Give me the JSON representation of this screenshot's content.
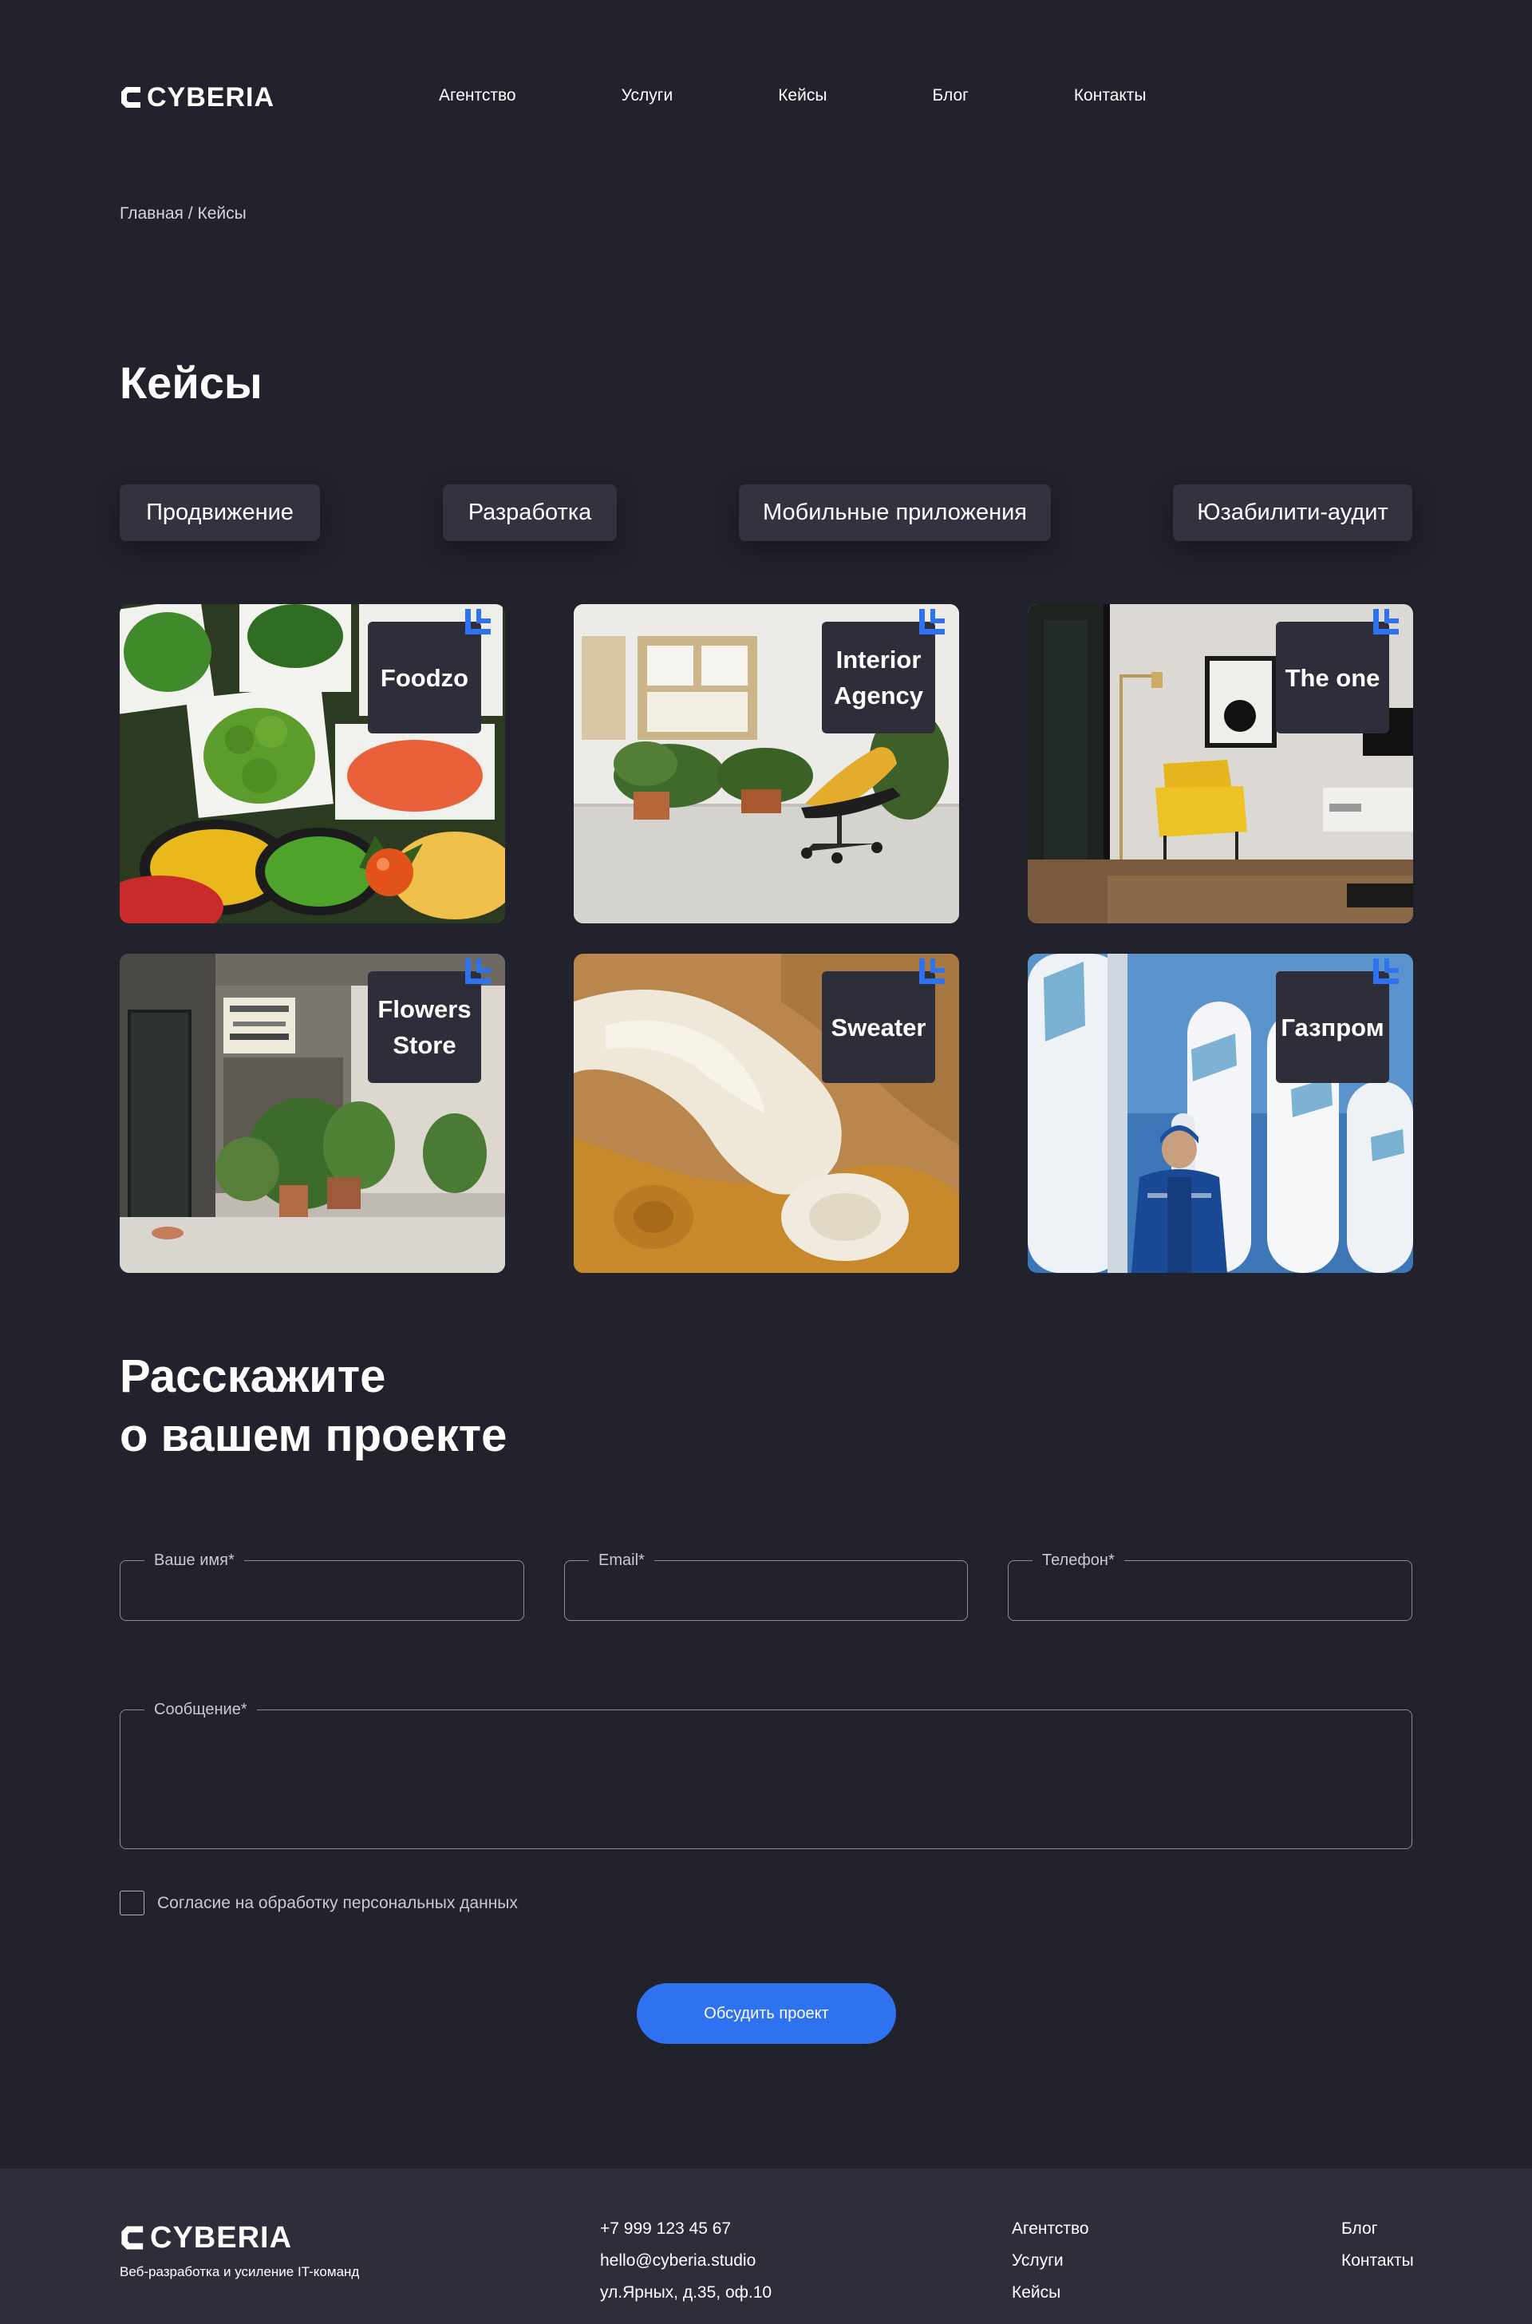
{
  "header": {
    "logo_text": "CYBERIA",
    "nav": [
      "Агентство",
      "Услуги",
      "Кейсы",
      "Блог",
      "Контакты"
    ]
  },
  "breadcrumb": {
    "home": "Главная",
    "separator": "/",
    "current": "Кейсы"
  },
  "page_title": "Кейсы",
  "filters": [
    "Продвижение",
    "Разработка",
    "Мобильные приложения",
    "Юзабилити-аудит"
  ],
  "cases": [
    {
      "label_1": "Foodzo",
      "label_2": ""
    },
    {
      "label_1": "Interior",
      "label_2": "Agency"
    },
    {
      "label_1": "The one",
      "label_2": ""
    },
    {
      "label_1": "Flowers",
      "label_2": "Store"
    },
    {
      "label_1": "Sweater",
      "label_2": ""
    },
    {
      "label_1": "Газпром",
      "label_2": ""
    }
  ],
  "form": {
    "title_line1": "Расскажите",
    "title_line2": "о вашем проекте",
    "name_label": "Ваше имя*",
    "name_value": "",
    "email_label": "Email*",
    "email_value": "",
    "phone_label": "Телефон*",
    "phone_value": "",
    "message_label": "Сообщение*",
    "message_value": "",
    "consent_text": "Согласие на обработку персональных данных",
    "consent_checked": false,
    "submit_label": "Обсудить проект"
  },
  "footer": {
    "logo_text": "CYBERIA",
    "tagline": "Веб-разработка и усиление IT-команд",
    "phone": "+7 999 123 45 67",
    "email": "hello@cyberia.studio",
    "address": "ул.Ярных, д.35, оф.10",
    "links_col1": [
      "Агентство",
      "Услуги",
      "Кейсы"
    ],
    "links_col2": [
      "Блог",
      "Контакты"
    ]
  },
  "colors": {
    "background": "#22222d",
    "card_label_bg": "#2e2e3a",
    "accent": "#2e72f0",
    "footer_bg": "#2e2e3a"
  }
}
